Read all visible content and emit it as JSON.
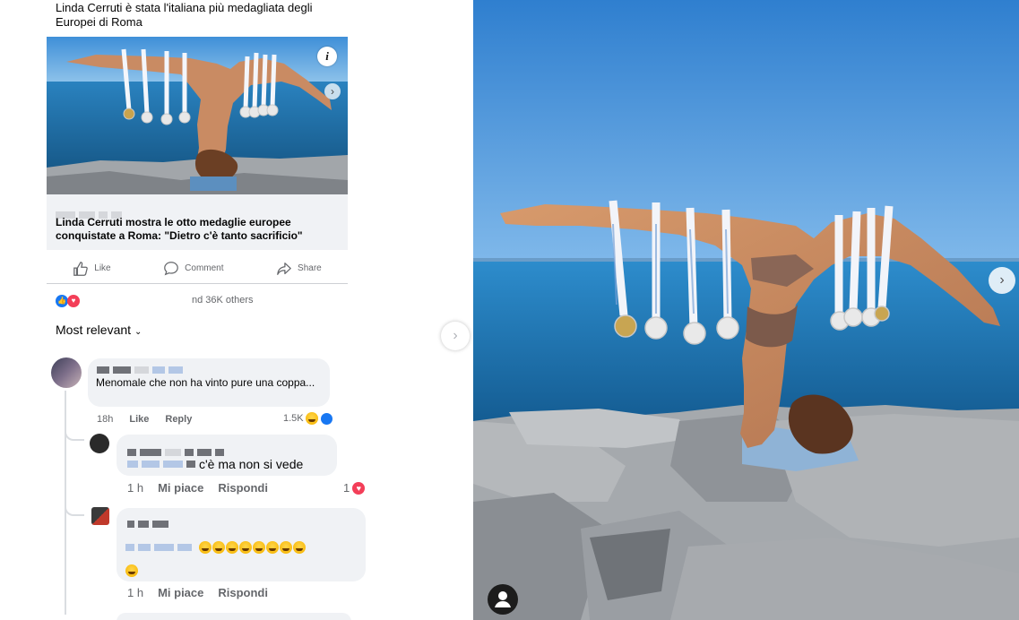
{
  "post": {
    "headline": "Linda Cerruti è stata l'italiana più medagliata degli Europei di Roma",
    "link_title": "Linda Cerruti mostra le otto medaglie europee conquistate a Roma: \"Dietro c'è tanto sacrificio\"",
    "info_glyph": "i",
    "arrow_glyph": "›",
    "actions": {
      "like": "Like",
      "comment": "Comment",
      "share": "Share"
    },
    "reactions_text": "nd 36K others",
    "sort_label": "Most relevant"
  },
  "comments": [
    {
      "text": "Menomale che non ha vinto pure una coppa...",
      "time": "18h",
      "like": "Like",
      "reply": "Reply",
      "count": "1.5K"
    },
    {
      "text": "c'è ma non si vede",
      "time": "1 h",
      "like": "Mi piace",
      "reply": "Rispondi",
      "count": "1"
    },
    {
      "text": "",
      "time": "1 h",
      "like": "Mi piace",
      "reply": "Rispondi"
    }
  ],
  "icons": {
    "like": "thumbs-up-icon",
    "comment": "speech-bubble-icon",
    "share": "share-arrow-icon",
    "info": "info-icon",
    "next": "chevron-right-icon",
    "user": "user-icon"
  },
  "colors": {
    "facebook_blue": "#1877f2",
    "love_red": "#f33e58",
    "sky": "#3b86cf",
    "sea": "#1f6aa3",
    "rock": "#9a9ea3"
  }
}
